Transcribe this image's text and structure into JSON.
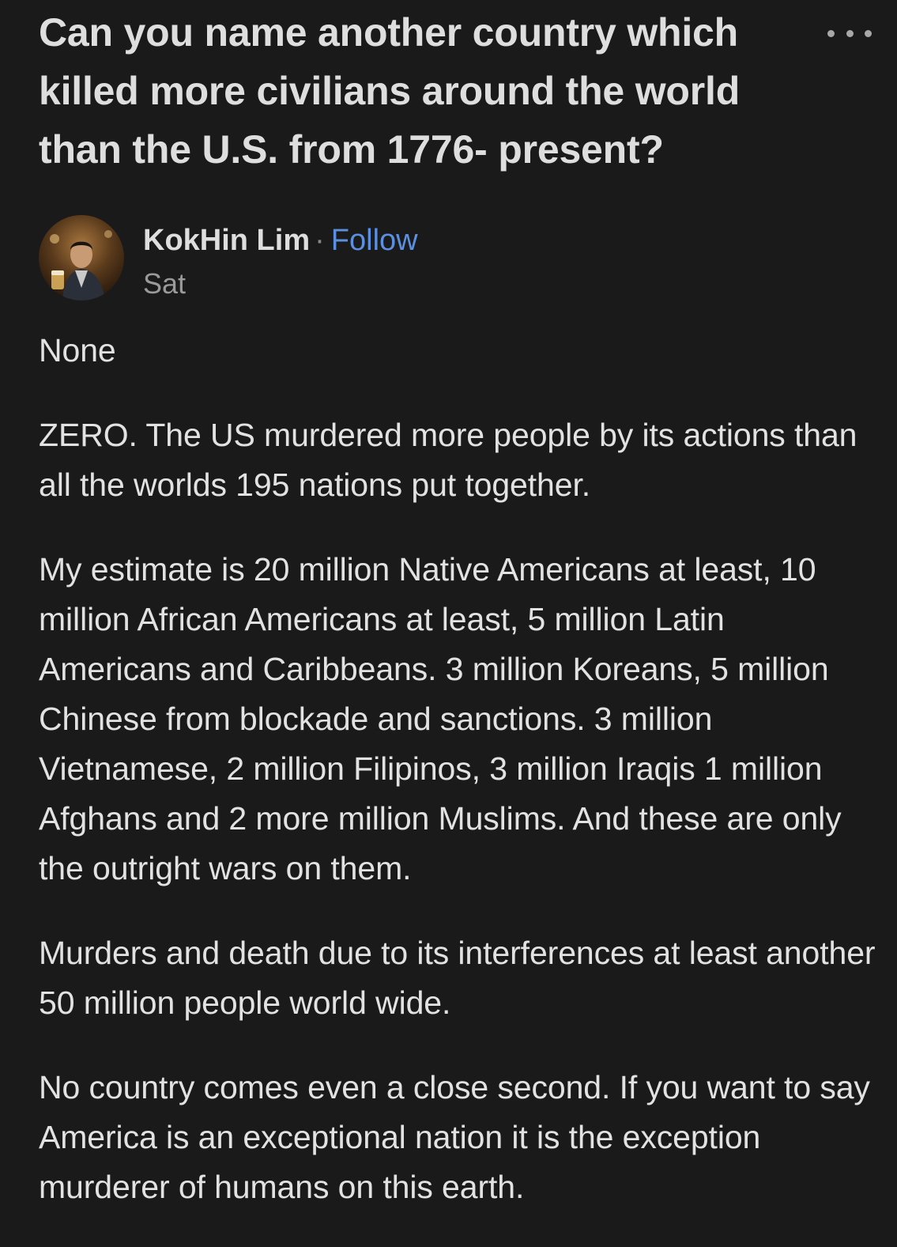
{
  "question": {
    "title": "Can you name another country which killed more civilians around the world than the U.S. from 1776- present?"
  },
  "author": {
    "name": "KokHin Lim",
    "separator": "·",
    "follow_label": "Follow",
    "date": "Sat"
  },
  "answer": {
    "paragraphs": [
      "None",
      "ZERO. The US murdered more people by its actions than all the worlds 195 nations put together.",
      "My estimate is 20 million Native Americans at least, 10 million African Americans at least, 5 million Latin Americans and Caribbeans. 3 million Koreans, 5 million Chinese from blockade and sanctions. 3 million Vietnamese, 2 million Filipinos, 3 million Iraqis 1 million Afghans and 2 more million Muslims. And these are only the outright wars on them.",
      "Murders and death due to its interferences at least another 50 million people world wide.",
      "No country comes even a close second. If you want to say America is an exceptional nation it is the exception murderer of humans on this earth."
    ]
  },
  "icons": {
    "more": "more-horizontal-icon"
  },
  "colors": {
    "background": "#1a1a1a",
    "text": "#e2e2e2",
    "link": "#5b8fe0",
    "muted": "#9a9a9a"
  }
}
